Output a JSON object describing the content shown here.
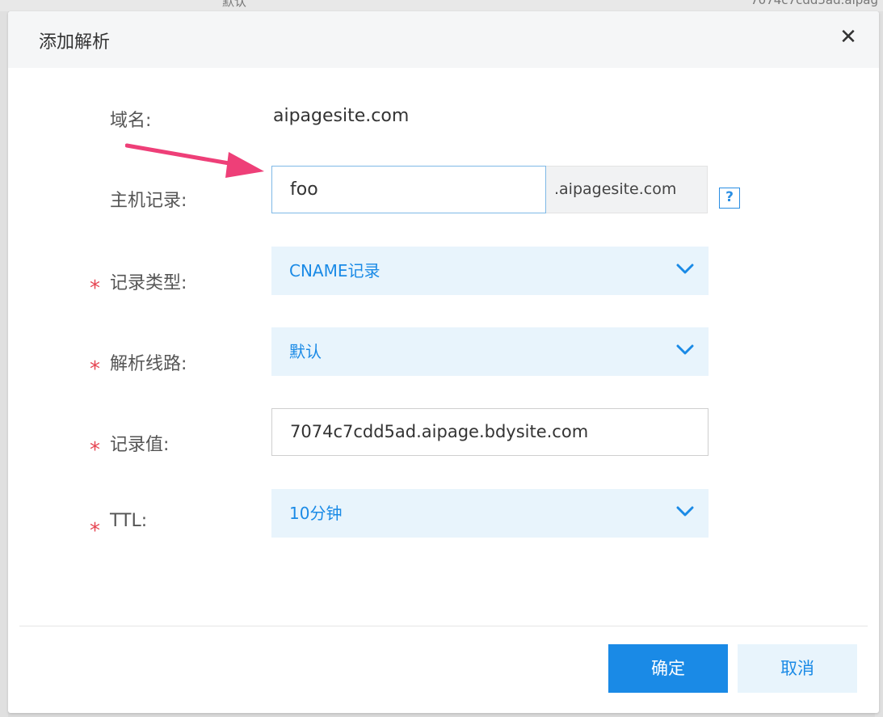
{
  "background": {
    "left_text": "默认",
    "right_text": "7074c7cdd5ad.aipag"
  },
  "dialog": {
    "title": "添加解析",
    "close_glyph": "✕"
  },
  "form": {
    "domain": {
      "label": "域名:",
      "value": "aipagesite.com"
    },
    "host": {
      "label": "主机记录:",
      "value": "foo",
      "suffix": ".aipagesite.com",
      "help_glyph": "?"
    },
    "record_type": {
      "label": "记录类型:",
      "value": "CNAME记录",
      "required": true
    },
    "line": {
      "label": "解析线路:",
      "value": "默认",
      "required": true
    },
    "record_value": {
      "label": "记录值:",
      "value": "7074c7cdd5ad.aipage.bdysite.com",
      "required": true
    },
    "ttl": {
      "label": "TTL:",
      "value": "10分钟",
      "required": true
    },
    "required_mark": "*"
  },
  "buttons": {
    "confirm": "确定",
    "cancel": "取消"
  },
  "colors": {
    "accent": "#1a8ae6",
    "select_bg": "#e8f4fc",
    "required": "#e64552",
    "annotation_arrow": "#ee3f78"
  },
  "icons": {
    "close": "close-icon",
    "help": "help-icon",
    "dropdown": "chevron-down-icon",
    "annotation": "arrow-icon"
  }
}
